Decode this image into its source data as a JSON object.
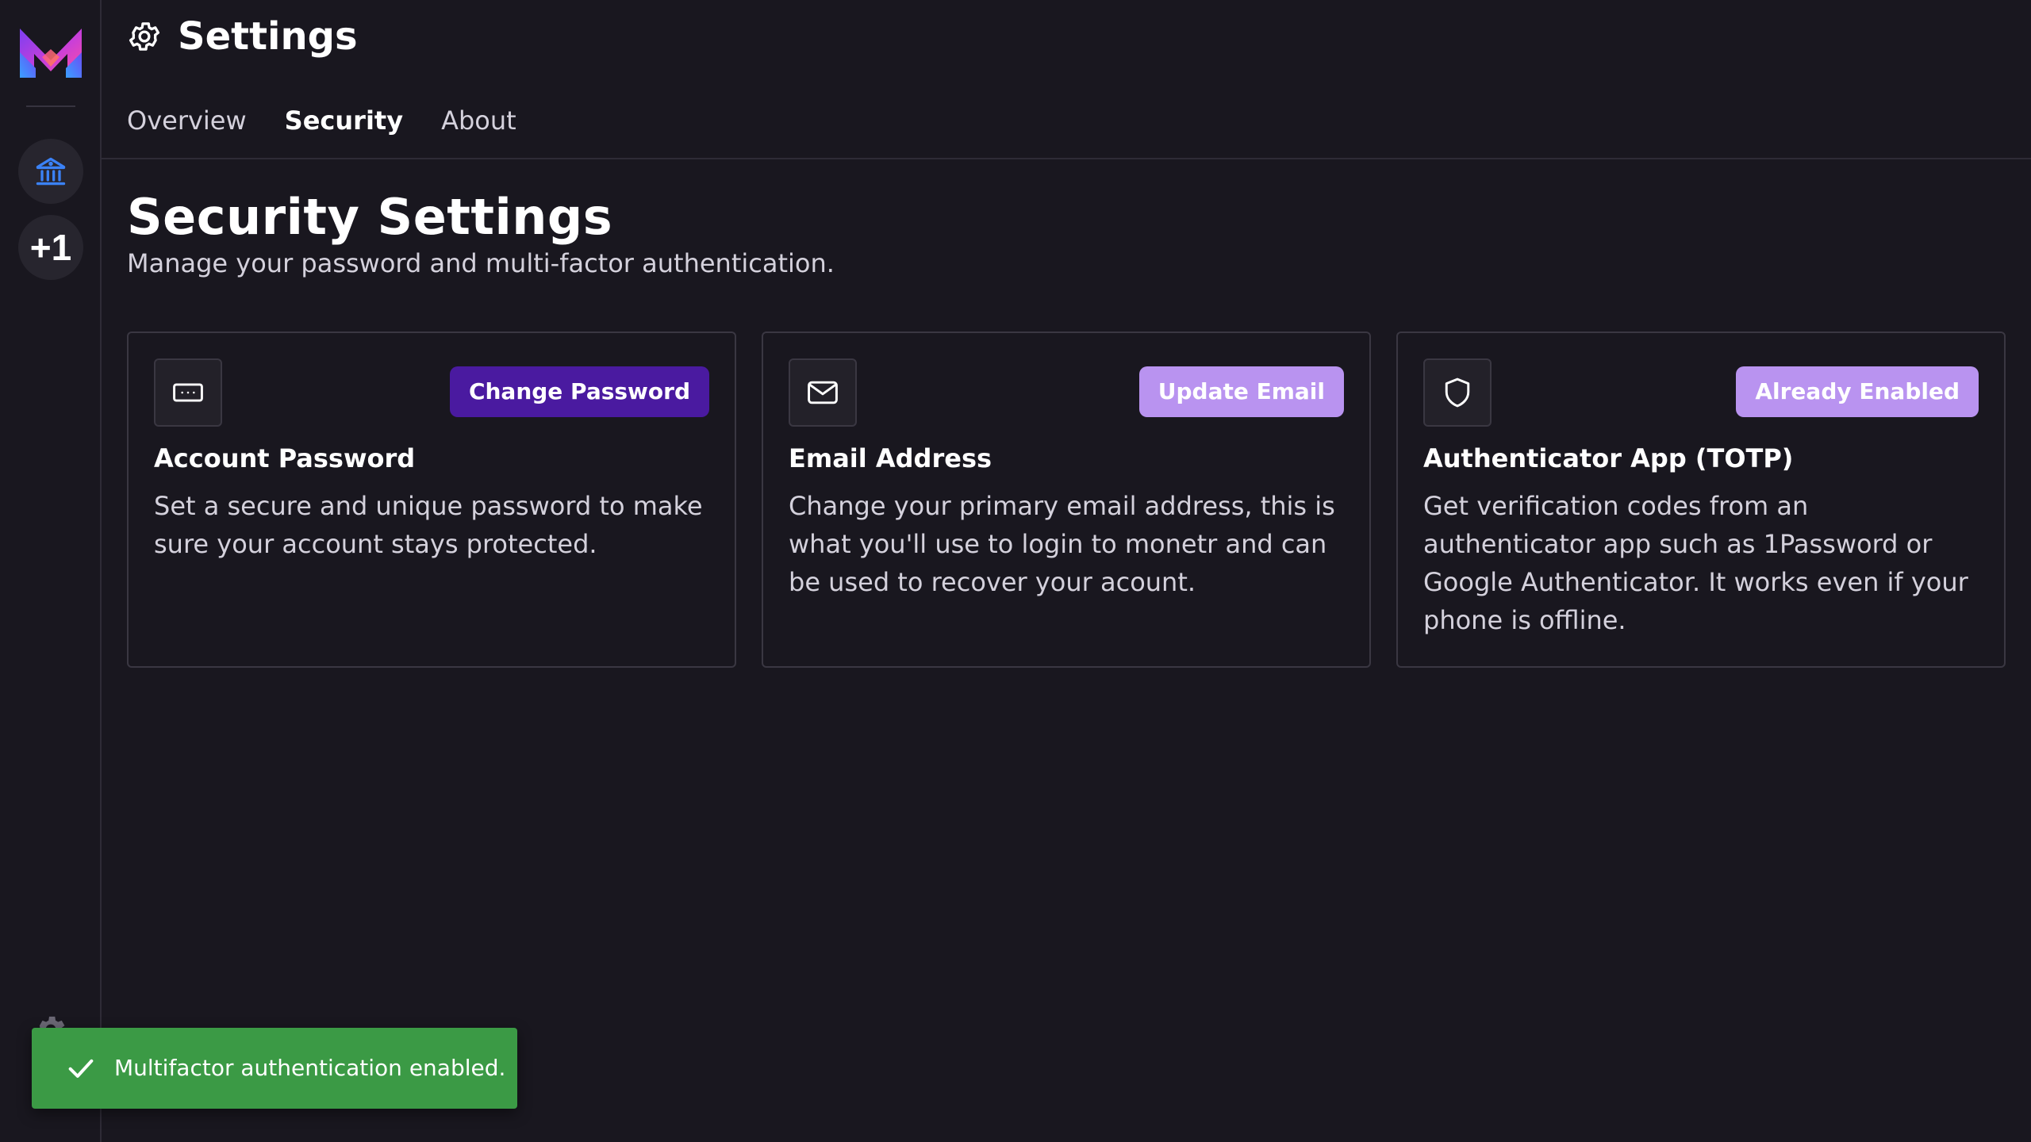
{
  "app": {
    "colors": {
      "background": "#19171f",
      "border": "#3a3742",
      "accent_dark": "#4a1aa0",
      "accent_light": "#b993f0",
      "success": "#3b9a45",
      "bank_icon": "#3b82f6"
    }
  },
  "sidebar": {
    "logo_icon": "monetr-logo-icon",
    "bank_icon": "bank-icon",
    "add_label": "+1",
    "settings_icon": "gear-icon"
  },
  "header": {
    "title": "Settings",
    "icon": "gear-icon"
  },
  "tabs": [
    {
      "label": "Overview",
      "active": false
    },
    {
      "label": "Security",
      "active": true
    },
    {
      "label": "About",
      "active": false
    }
  ],
  "content": {
    "title": "Security Settings",
    "subtitle": "Manage your password and multi-factor authentication."
  },
  "cards": [
    {
      "icon": "password-field-icon",
      "button_label": "Change Password",
      "title": "Account Password",
      "description": "Set a secure and unique password to make sure your account stays protected."
    },
    {
      "icon": "mail-icon",
      "button_label": "Update Email",
      "title": "Email Address",
      "description": "Change your primary email address, this is what you'll use to login to monetr and can be used to recover your acount."
    },
    {
      "icon": "shield-icon",
      "button_label": "Already Enabled",
      "title": "Authenticator App (TOTP)",
      "description": "Get verification codes from an authenticator app such as 1Password or Google Authenticator. It works even if your phone is offline."
    }
  ],
  "toast": {
    "icon": "check-icon",
    "message": "Multifactor authentication enabled."
  }
}
